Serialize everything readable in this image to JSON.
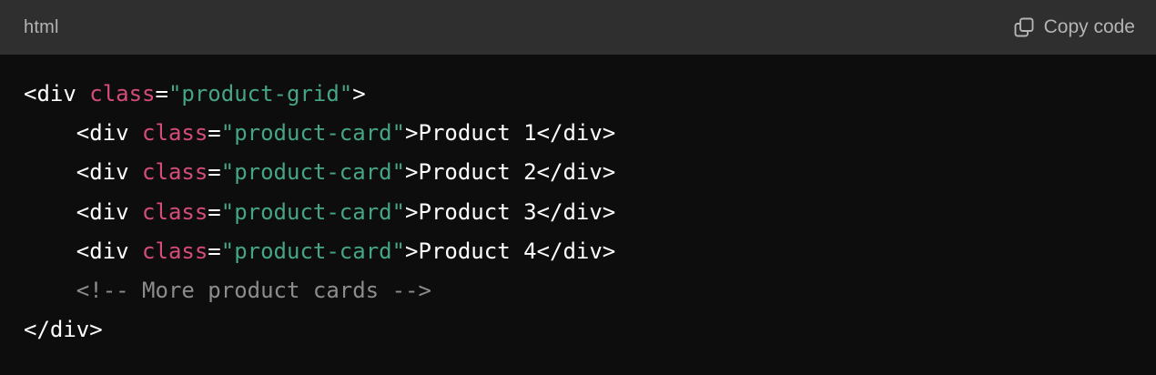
{
  "header": {
    "language": "html",
    "copy_label": "Copy code",
    "copy_icon": "copy-icon"
  },
  "colors": {
    "header_bg": "#2f2f2f",
    "code_bg": "#0d0d0d",
    "attr": "#d64c7a",
    "string": "#46a583",
    "comment": "#8c8c8c",
    "text": "#ffffff"
  },
  "code": {
    "line1": {
      "open": "<div ",
      "attr": "class",
      "eq": "=",
      "value": "\"product-grid\"",
      "close": ">"
    },
    "line2": {
      "indent": "    ",
      "open": "<div ",
      "attr": "class",
      "eq": "=",
      "value": "\"product-card\"",
      "close": ">",
      "content": "Product 1",
      "end": "</div>"
    },
    "line3": {
      "indent": "    ",
      "open": "<div ",
      "attr": "class",
      "eq": "=",
      "value": "\"product-card\"",
      "close": ">",
      "content": "Product 2",
      "end": "</div>"
    },
    "line4": {
      "indent": "    ",
      "open": "<div ",
      "attr": "class",
      "eq": "=",
      "value": "\"product-card\"",
      "close": ">",
      "content": "Product 3",
      "end": "</div>"
    },
    "line5": {
      "indent": "    ",
      "open": "<div ",
      "attr": "class",
      "eq": "=",
      "value": "\"product-card\"",
      "close": ">",
      "content": "Product 4",
      "end": "</div>"
    },
    "line6": {
      "indent": "    ",
      "comment": "<!-- More product cards -->"
    },
    "line7": {
      "end": "</div>"
    }
  }
}
